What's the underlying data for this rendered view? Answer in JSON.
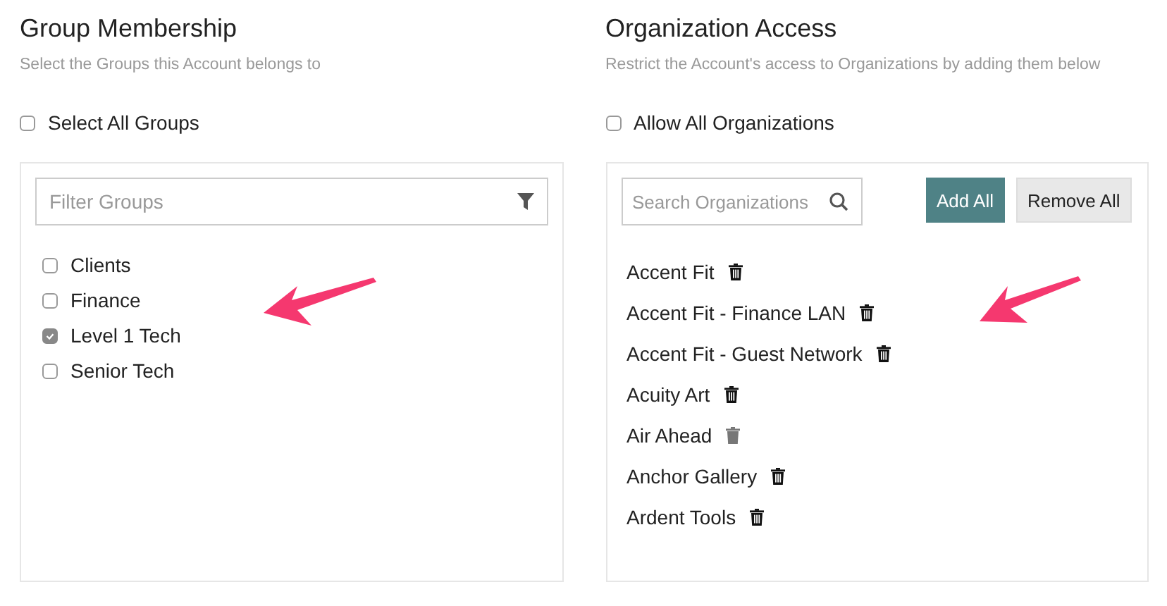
{
  "groups": {
    "title": "Group Membership",
    "subtitle": "Select the Groups this Account belongs to",
    "select_all": {
      "label": "Select All Groups",
      "checked": false
    },
    "filter": {
      "placeholder": "Filter Groups"
    },
    "items": [
      {
        "label": "Clients",
        "checked": false
      },
      {
        "label": "Finance",
        "checked": false
      },
      {
        "label": "Level 1 Tech",
        "checked": true
      },
      {
        "label": "Senior Tech",
        "checked": false
      }
    ]
  },
  "organizations": {
    "title": "Organization Access",
    "subtitle": "Restrict the Account's access to Organizations by adding them below",
    "allow_all": {
      "label": "Allow All Organizations",
      "checked": false
    },
    "search": {
      "placeholder": "Search Organizations"
    },
    "buttons": [
      {
        "label": "Add All",
        "kind": "primary"
      },
      {
        "label": "Remove All",
        "kind": "secondary"
      }
    ],
    "items": [
      {
        "label": "Accent Fit",
        "hovered": false
      },
      {
        "label": "Accent Fit - Finance LAN",
        "hovered": false
      },
      {
        "label": "Accent Fit - Guest Network",
        "hovered": false
      },
      {
        "label": "Acuity Art",
        "hovered": false
      },
      {
        "label": "Air Ahead",
        "hovered": true
      },
      {
        "label": "Anchor Gallery",
        "hovered": false
      },
      {
        "label": "Ardent Tools",
        "hovered": false
      }
    ]
  }
}
